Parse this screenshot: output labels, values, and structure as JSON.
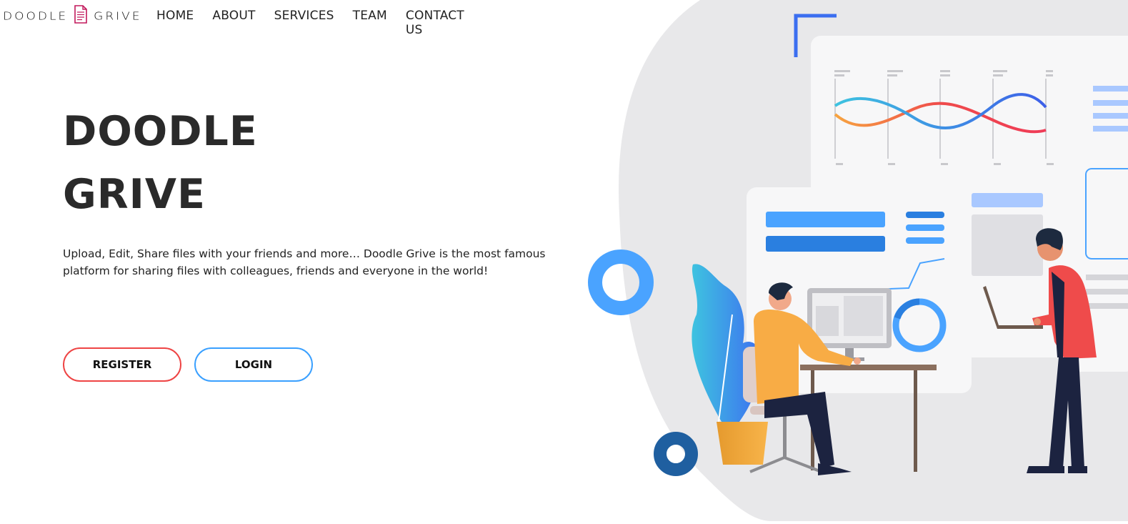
{
  "brand": {
    "logo_left": "DOODLE",
    "logo_right": "GRIVE",
    "logo_icon": "document-icon",
    "accent_color": "#c2185b"
  },
  "nav": {
    "items": [
      {
        "label": "HOME"
      },
      {
        "label": "ABOUT"
      },
      {
        "label": "SERVICES"
      },
      {
        "label": "TEAM"
      },
      {
        "label": "CONTACT US"
      }
    ]
  },
  "hero": {
    "title_line1": "DOODLE",
    "title_line2": "GRIVE",
    "description": "Upload, Edit, Share files with your friends and more… Doodle Grive is the most famous platform for sharing files with colleagues, friends and everyone in the world!",
    "register_label": "REGISTER",
    "login_label": "LOGIN",
    "register_color": "#ee4444",
    "login_color": "#3aa0ff"
  }
}
